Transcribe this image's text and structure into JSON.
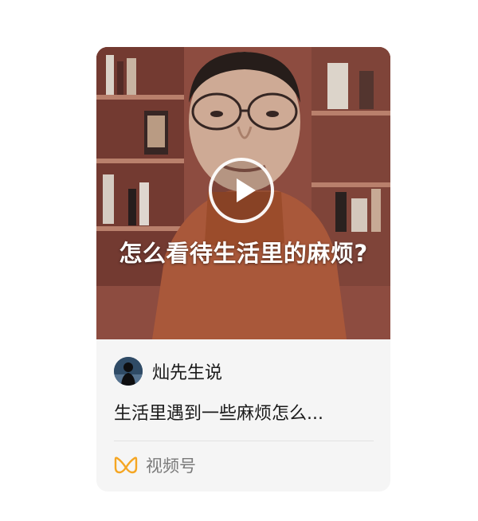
{
  "card": {
    "video": {
      "caption": "怎么看待生活里的麻烦?",
      "play_icon": "play-icon"
    },
    "author": {
      "name": "灿先生说",
      "avatar_icon": "avatar"
    },
    "description": "生活里遇到一些麻烦怎么...",
    "source": {
      "label": "视频号",
      "icon": "channels-icon",
      "icon_color": "#f5a623"
    }
  }
}
